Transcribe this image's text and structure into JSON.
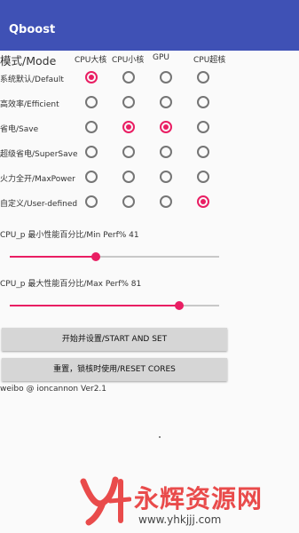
{
  "app": {
    "title": "Qboost"
  },
  "mode_label": "模式/Mode",
  "columns": [
    "CPU大核",
    "CPU小核",
    "GPU",
    "CPU超核"
  ],
  "rows": [
    {
      "label": "系统默认/Default",
      "checked": [
        true,
        false,
        false,
        false
      ]
    },
    {
      "label": "高效率/Efficient",
      "checked": [
        false,
        false,
        false,
        false
      ]
    },
    {
      "label": "省电/Save",
      "checked": [
        false,
        true,
        true,
        false
      ]
    },
    {
      "label": "超级省电/SuperSave",
      "checked": [
        false,
        false,
        false,
        false
      ]
    },
    {
      "label": "火力全开/MaxPower",
      "checked": [
        false,
        false,
        false,
        false
      ]
    },
    {
      "label": "自定义/User-defined",
      "checked": [
        false,
        false,
        false,
        true
      ]
    }
  ],
  "sliders": {
    "min": {
      "label": "CPU_p 最小性能百分比/Min Perf% 41",
      "value": 41
    },
    "max": {
      "label": "CPU_p 最大性能百分比/Max Perf% 81",
      "value": 81
    }
  },
  "buttons": {
    "start": "开始并设置/START AND SET",
    "reset": "重置，锁核时使用/RESET CORES"
  },
  "credit": "weibo @ ioncannon Ver2.1",
  "watermark": {
    "text": "永辉资源网",
    "url": "www.yhkjjj.com"
  },
  "colors": {
    "appbar": "#3f51b5",
    "accent": "#e91e63"
  }
}
